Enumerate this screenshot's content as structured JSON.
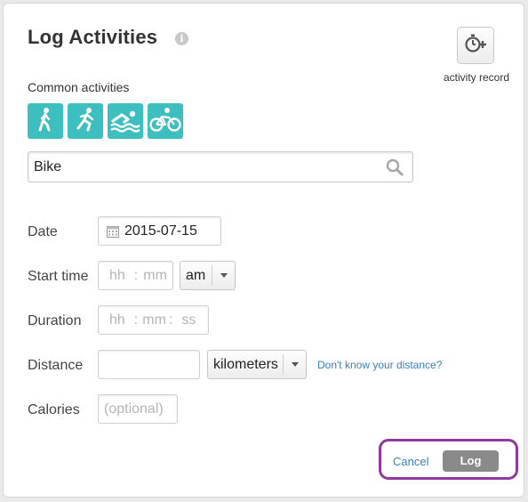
{
  "header": {
    "title": "Log Activities",
    "info_glyph": "i"
  },
  "activity_record": {
    "label": "activity record",
    "icon": "stopwatch-plus-icon"
  },
  "common_activities": {
    "label": "Common activities",
    "color": "#3dbfbf",
    "items": [
      {
        "name": "walk",
        "icon": "walking-icon"
      },
      {
        "name": "run",
        "icon": "running-icon"
      },
      {
        "name": "swim",
        "icon": "swimming-icon"
      },
      {
        "name": "bike",
        "icon": "cycling-icon"
      }
    ]
  },
  "search": {
    "value": "Bike",
    "icon": "search-icon"
  },
  "form": {
    "date": {
      "label": "Date",
      "value": "2015-07-15",
      "icon": "calendar-icon"
    },
    "start_time": {
      "label": "Start time",
      "hh": "hh",
      "sep": ":",
      "mm": "mm",
      "ampm": "am"
    },
    "duration": {
      "label": "Duration",
      "hh": "hh",
      "mm": "mm",
      "ss": "ss",
      "sep": ":"
    },
    "distance": {
      "label": "Distance",
      "value": "",
      "unit": "kilometers",
      "help_link": "Don't know your distance?"
    },
    "calories": {
      "label": "Calories",
      "placeholder": "(optional)"
    }
  },
  "footer": {
    "cancel_label": "Cancel",
    "log_label": "Log",
    "highlight_color": "#8e3a9e"
  }
}
